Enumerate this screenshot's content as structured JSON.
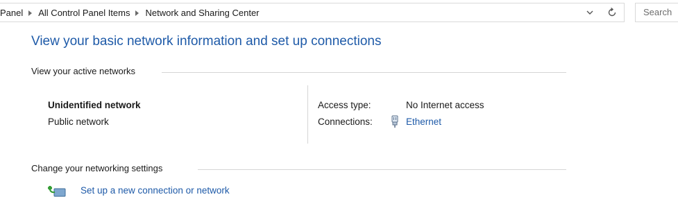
{
  "address_bar": {
    "crumbs": [
      "Panel",
      "All Control Panel Items",
      "Network and Sharing Center"
    ],
    "search_placeholder": "Search"
  },
  "main": {
    "title": "View your basic network information and set up connections",
    "active_networks_heading": "View your active networks",
    "network": {
      "name": "Unidentified network",
      "type": "Public network",
      "access_type_label": "Access type:",
      "access_type_value": "No Internet access",
      "connections_label": "Connections:",
      "connection_name": "Ethernet"
    },
    "change_settings_heading": "Change your networking settings",
    "setup_link": "Set up a new connection or network"
  },
  "icons": {
    "dropdown": "chevron-down-icon",
    "refresh": "refresh-icon",
    "ethernet": "ethernet-icon",
    "setup": "new-connection-icon"
  },
  "colors": {
    "title": "#1e5aa8",
    "link": "#1e5aa8"
  }
}
